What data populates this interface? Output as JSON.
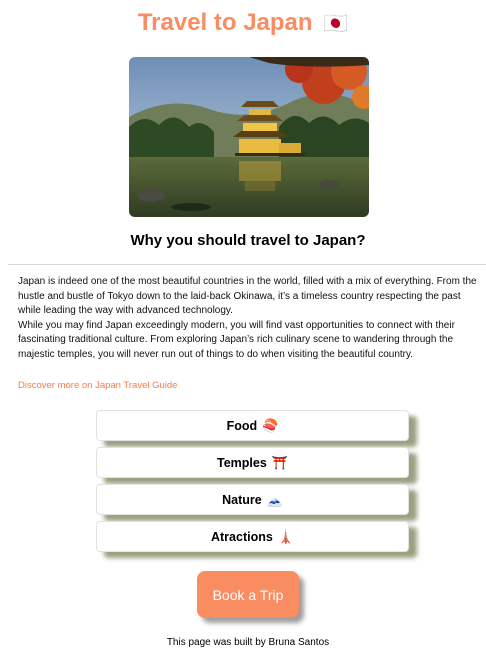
{
  "header": {
    "title": "Travel to Japan",
    "flag_emoji": "🇯🇵"
  },
  "hero_image": {
    "alt": "Golden temple by a lake in Japan",
    "icon": "golden-pavilion-photo"
  },
  "section": {
    "heading": "Why you should travel to Japan?"
  },
  "intro": {
    "paragraph_1": "Japan is indeed one of the most beautiful countries in the world, filled with a mix of everything. From the hustle and bustle of Tokyo down to the laid-back Okinawa, it’s a timeless country respecting the past while leading the way with advanced technology.",
    "paragraph_2": "While you may find Japan exceedingly modern, you will find vast opportunities to connect with their fascinating traditional culture. From exploring Japan’s rich culinary scene to wandering through the majestic temples, you will never run out of things to do when visiting the beautiful country."
  },
  "link": {
    "text": "Discover more on Japan Travel Guide"
  },
  "topics": [
    {
      "label": "Food",
      "emoji": "🍣"
    },
    {
      "label": "Temples",
      "emoji": "⛩️"
    },
    {
      "label": "Nature",
      "emoji": "🗻"
    },
    {
      "label": "Atractions",
      "emoji": "🗼"
    }
  ],
  "cta": {
    "label": "Book a Trip"
  },
  "footer": {
    "text": "This page was built by Bruna Santos"
  },
  "colors": {
    "accent": "#fa8c62",
    "link": "#fa7a45",
    "button_shadow": "#9c9f80"
  }
}
